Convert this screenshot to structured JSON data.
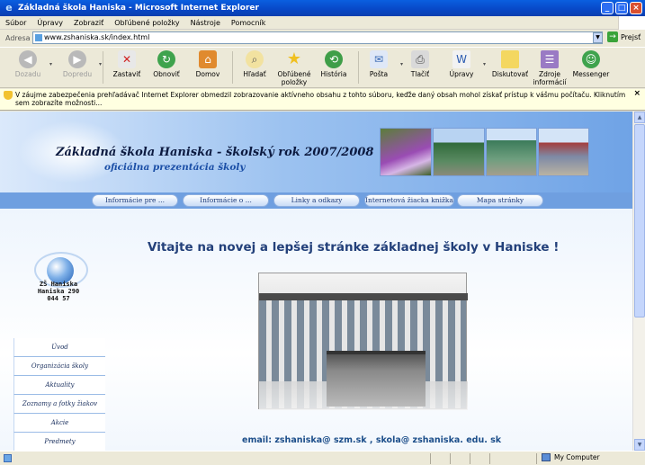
{
  "window": {
    "title": "Základná škola Haniska - Microsoft Internet Explorer",
    "controls": [
      "_",
      "□",
      "×"
    ]
  },
  "menu": [
    "Súbor",
    "Úpravy",
    "Zobraziť",
    "Obľúbené položky",
    "Nástroje",
    "Pomocník"
  ],
  "address": {
    "label": "Adresa",
    "url": "www.zshaniska.sk/index.html",
    "go_label": "Prejsť"
  },
  "toolbar": {
    "back": "Dozadu",
    "forward": "Dopredu",
    "stop": "Zastaviť",
    "refresh": "Obnoviť",
    "home": "Domov",
    "search": "Hľadať",
    "favorites": "Obľúbené položky",
    "history": "História",
    "mail": "Pošta",
    "print": "Tlačiť",
    "edit": "Úpravy",
    "discuss": "Diskutovať",
    "research": "Zdroje informácií",
    "messenger": "Messenger"
  },
  "infobar": {
    "text": "V záujme zabezpečenia prehľadávač Internet Explorer obmedzil zobrazovanie aktívneho obsahu z tohto súboru, keďže daný obsah mohol získať prístup k vášmu počítaču. Kliknutím sem zobrazíte možnosti...",
    "close": "×"
  },
  "page": {
    "banner_title": "Základná škola Haniska - školský rok 2007/2008",
    "banner_subtitle": "oficiálna prezentácia školy",
    "nav": [
      "Informácie pre ...",
      "Informácie o ...",
      "Linky a odkazy",
      "Internetová žiacka knižka",
      "Mapa stránky"
    ],
    "welcome": "Vitajte na novej a lepšej stránke základnej školy v Haniske !",
    "logo_text": [
      "ZŠ Haniska",
      "Haniska 290",
      "044 57"
    ],
    "side_menu": [
      "Úvod",
      "Organizácia školy",
      "Aktuality",
      "Zoznamy a fotky žiakov",
      "Akcie",
      "Predmety"
    ],
    "email": "email: zshaniska@ szm.sk , skola@ zshaniska. edu. sk"
  },
  "status": {
    "zone": "My Computer"
  },
  "colors": {
    "titlebar": "#0847c6",
    "banner_dark": "#6fa3e6",
    "heading": "#23407a",
    "email": "#1c4e8a"
  }
}
